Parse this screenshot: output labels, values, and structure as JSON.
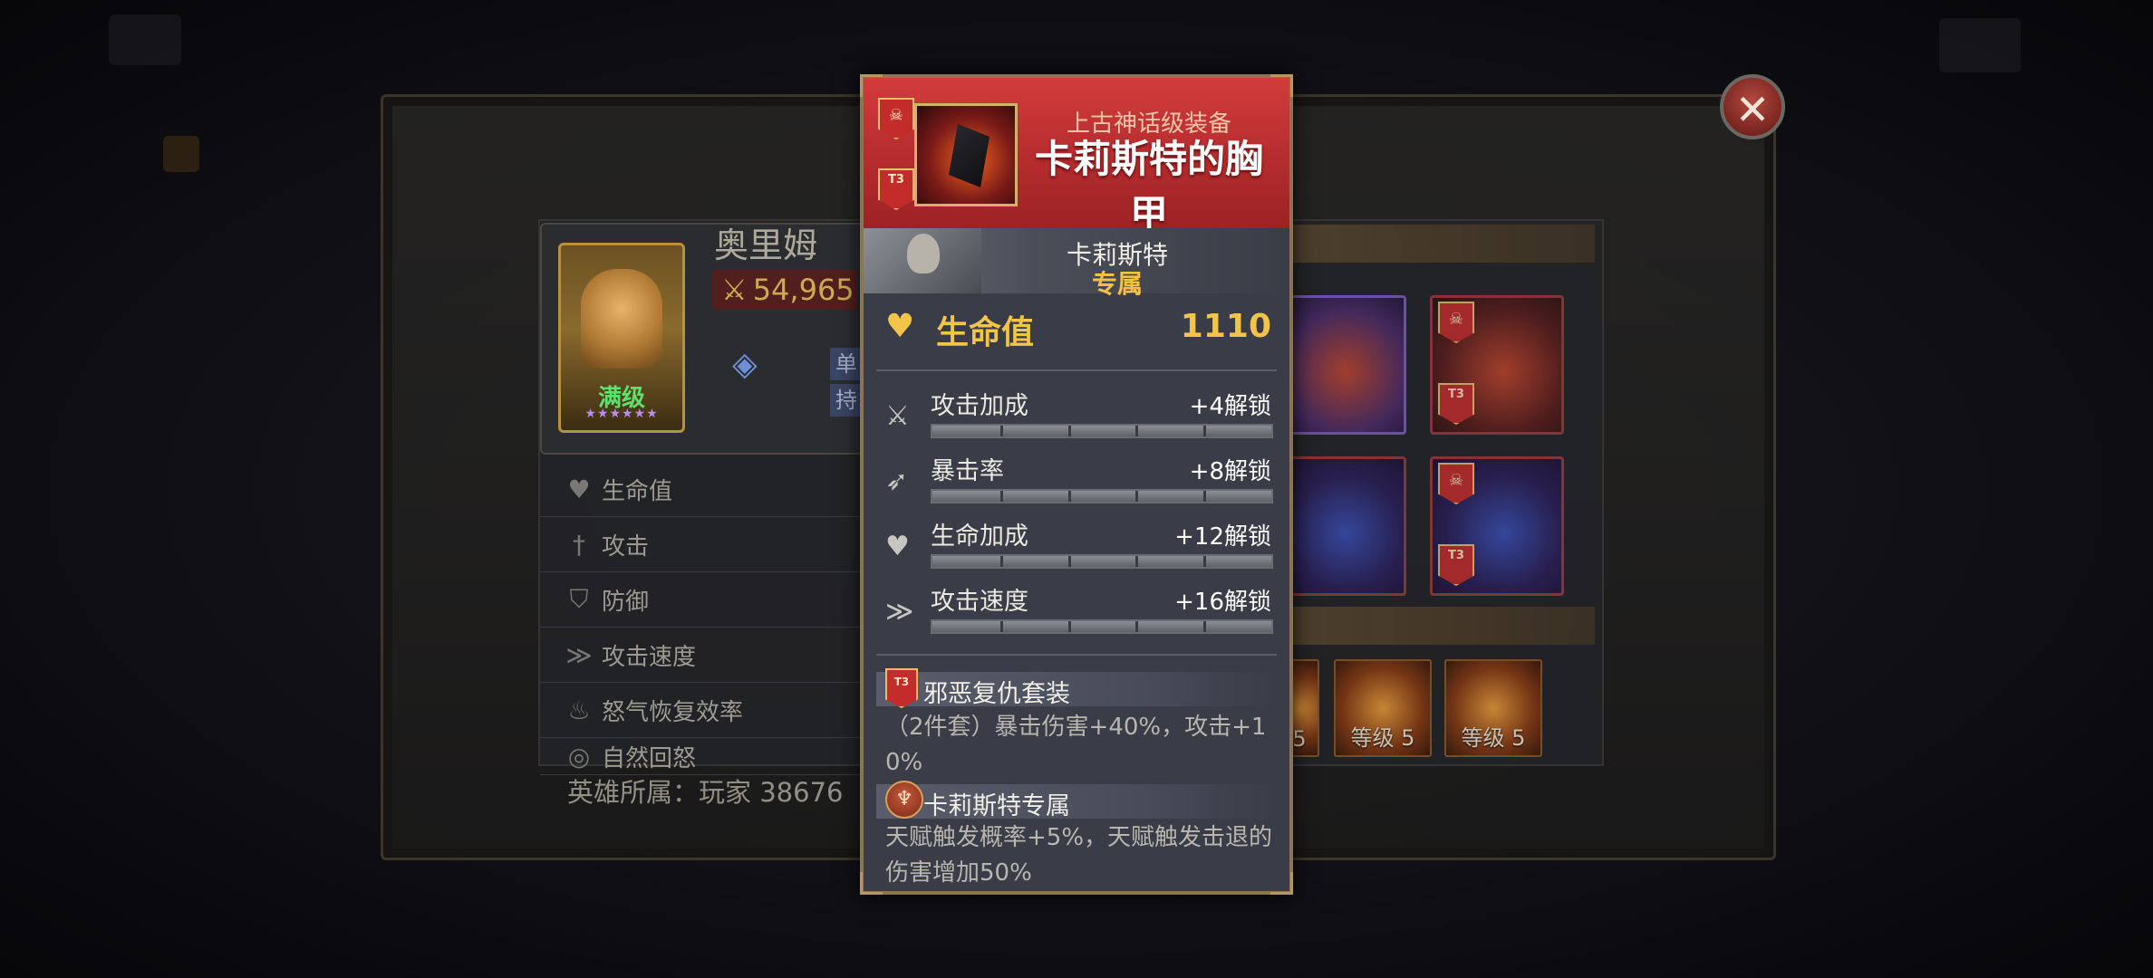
{
  "background": {
    "hero": {
      "name": "奥里姆",
      "power": "54,965",
      "level_label": "满级",
      "stars": "★★★★★★",
      "tags": [
        "单",
        "持"
      ]
    },
    "stats": [
      {
        "label": "生命值",
        "icon": "heart-icon"
      },
      {
        "label": "攻击",
        "icon": "sword-icon"
      },
      {
        "label": "防御",
        "icon": "shield-icon"
      },
      {
        "label": "攻击速度",
        "icon": "wing-icon"
      },
      {
        "label": "怒气恢复效率",
        "icon": "flame-icon"
      },
      {
        "label": "自然回怒",
        "icon": "swirl-icon"
      }
    ],
    "owner_text": "英雄所属：玩家 38676",
    "equip_slot_badge": "T3",
    "skill_levels": [
      "5",
      "等级 5",
      "等级 5"
    ]
  },
  "tooltip": {
    "rarity": "上古神话级装备",
    "item_name": "卡莉斯特的胸甲",
    "tier_badge": "T3",
    "owner_name": "卡莉斯特",
    "owner_exclusive": "专属",
    "main_stat": {
      "label": "生命值",
      "value": "1110",
      "icon": "heart-icon"
    },
    "locked_stats": [
      {
        "label": "攻击加成",
        "unlock": "+4解锁",
        "icon": "sword-up-icon",
        "progress": 0
      },
      {
        "label": "暴击率",
        "unlock": "+8解锁",
        "icon": "arrow-crit-icon",
        "progress": 0
      },
      {
        "label": "生命加成",
        "unlock": "+12解锁",
        "icon": "heart-plus-icon",
        "progress": 0
      },
      {
        "label": "攻击速度",
        "unlock": "+16解锁",
        "icon": "wing-speed-icon",
        "progress": 0
      }
    ],
    "set_bonus": {
      "name": "邪恶复仇套装",
      "badge": "T3",
      "desc": "（2件套）暴击伤害+40%，攻击+10%"
    },
    "exclusive_bonus": {
      "name": "卡莉斯特专属",
      "desc": "天赋触发概率+5%，天赋触发击退的伤害增加50%"
    }
  },
  "colors": {
    "header_red": "#b52c2e",
    "gold_text": "#f3c44a",
    "panel_bg": "#3a3c47"
  }
}
